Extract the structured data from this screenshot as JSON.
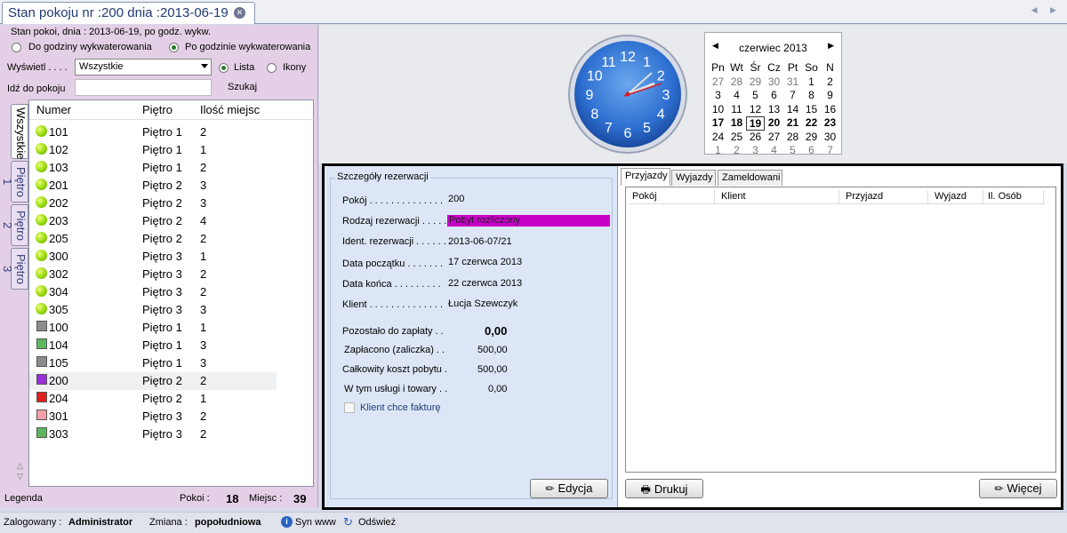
{
  "window": {
    "tab_title": "Stan pokoju nr :200 dnia :2013-06-19",
    "nav_arrows": "◀ ▶"
  },
  "left_panel": {
    "header": "Stan pokoi, dnia : 2013-06-19, po godz. wykw.",
    "radio_before": "Do godziny wykwaterowania",
    "radio_after": "Po godzinie wykwaterowania",
    "display_label": "Wyświetl . . . .",
    "display_value": "Wszystkie",
    "view_list": "Lista",
    "view_icons": "Ikony",
    "goto_label": "Idź do pokoju",
    "search_label": "Szukaj",
    "vertical_tabs": [
      "Wszystkie",
      "Piętro 1",
      "Piętro 2",
      "Piętro 3"
    ],
    "columns": [
      "Numer",
      "Piętro",
      "Ilość miejsc"
    ],
    "rooms": [
      {
        "number": "101",
        "floor": "Piętro 1",
        "places": "2",
        "marker": "dot"
      },
      {
        "number": "102",
        "floor": "Piętro 1",
        "places": "1",
        "marker": "dot"
      },
      {
        "number": "103",
        "floor": "Piętro 1",
        "places": "2",
        "marker": "dot"
      },
      {
        "number": "201",
        "floor": "Piętro 2",
        "places": "3",
        "marker": "dot"
      },
      {
        "number": "202",
        "floor": "Piętro 2",
        "places": "3",
        "marker": "dot"
      },
      {
        "number": "203",
        "floor": "Piętro 2",
        "places": "4",
        "marker": "dot"
      },
      {
        "number": "205",
        "floor": "Piętro 2",
        "places": "2",
        "marker": "dot"
      },
      {
        "number": "300",
        "floor": "Piętro 3",
        "places": "1",
        "marker": "dot"
      },
      {
        "number": "302",
        "floor": "Piętro 3",
        "places": "2",
        "marker": "dot"
      },
      {
        "number": "304",
        "floor": "Piętro 3",
        "places": "2",
        "marker": "dot"
      },
      {
        "number": "305",
        "floor": "Piętro 3",
        "places": "3",
        "marker": "dot"
      },
      {
        "number": "100",
        "floor": "Piętro 1",
        "places": "1",
        "marker": "#8c8c8c"
      },
      {
        "number": "104",
        "floor": "Piętro 1",
        "places": "3",
        "marker": "#5cb85c"
      },
      {
        "number": "105",
        "floor": "Piętro 1",
        "places": "3",
        "marker": "#8c8c8c"
      },
      {
        "number": "200",
        "floor": "Piętro 2",
        "places": "2",
        "marker": "#9b30d9"
      },
      {
        "number": "204",
        "floor": "Piętro 2",
        "places": "1",
        "marker": "#e01e1e"
      },
      {
        "number": "301",
        "floor": "Piętro 3",
        "places": "2",
        "marker": "#f4a0a8"
      },
      {
        "number": "303",
        "floor": "Piętro 3",
        "places": "2",
        "marker": "#5cb85c"
      }
    ],
    "legend": "Legenda",
    "rooms_label": "Pokoi :",
    "rooms_count": "18",
    "places_label": "Miejsc :",
    "places_count": "39"
  },
  "clock": {
    "numbers": [
      "12",
      "1",
      "2",
      "3",
      "4",
      "5",
      "6",
      "7",
      "8",
      "9",
      "10",
      "11"
    ]
  },
  "calendar": {
    "title": "czerwiec 2013",
    "weekdays": [
      "Pn",
      "Wt",
      "Śr",
      "Cz",
      "Pt",
      "So",
      "N"
    ],
    "weeks": [
      [
        "27",
        "28",
        "29",
        "30",
        "31",
        "1",
        "2"
      ],
      [
        "3",
        "4",
        "5",
        "6",
        "7",
        "8",
        "9"
      ],
      [
        "10",
        "11",
        "12",
        "13",
        "14",
        "15",
        "16"
      ],
      [
        "17",
        "18",
        "19",
        "20",
        "21",
        "22",
        "23"
      ],
      [
        "24",
        "25",
        "26",
        "27",
        "28",
        "29",
        "30"
      ],
      [
        "1",
        "2",
        "3",
        "4",
        "5",
        "6",
        "7"
      ]
    ],
    "selected_day": "19"
  },
  "details": {
    "legend": "Szczegóły rezerwacji",
    "room_label": "Pokój . . . . . . . . . . . . . .",
    "room_value": "200",
    "type_label": "Rodzaj rezerwacji . . . . .",
    "type_value": "Pobyt rozliczony",
    "ident_label": "Ident. rezerwacji . . . . . .",
    "ident_value": "2013-06-07/21",
    "start_label": "Data początku . . . . . . .",
    "start_value": "17 czerwca 2013",
    "end_label": "Data końca . . . . . . . . .",
    "end_value": "22 czerwca 2013",
    "client_label": "Klient . . . . . . . . . . . . . .",
    "client_value": "Łucja Szewczyk",
    "due_label": "Pozostało do zapłaty . .",
    "due_value": "0,00",
    "paid_label": "Zapłacono (zaliczka) . .",
    "paid_value": "500,00",
    "total_label": "Całkowity koszt pobytu .",
    "total_value": "500,00",
    "services_label": "W tym usługi i towary . .",
    "services_value": "0,00",
    "invoice_label": "Klient chce fakturę",
    "edit_button": "Edycja"
  },
  "tabs_panel": {
    "tabs": [
      "Przyjazdy",
      "Wyjazdy",
      "Zameldowani"
    ],
    "columns": [
      "Pokój",
      "Klient",
      "Przyjazd",
      "Wyjazd",
      "Il. Osób"
    ],
    "print_button": "Drukuj",
    "more_button": "Więcej"
  },
  "status_bar": {
    "user_label": "Zalogowany :",
    "user_value": "Administrator",
    "shift_label": "Zmiana :",
    "shift_value": "popołudniowa",
    "sync_label": "Syn www",
    "refresh_label": "Odśwież"
  }
}
